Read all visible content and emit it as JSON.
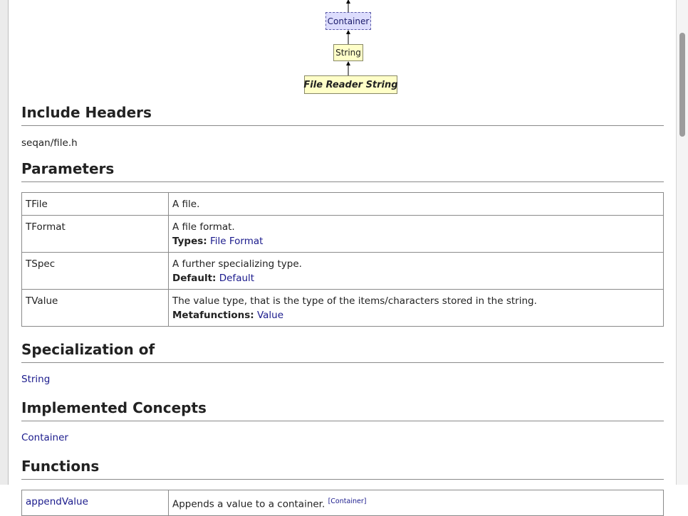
{
  "diagram": {
    "container_label": "Container",
    "string_label": "String",
    "current_label": "File Reader String"
  },
  "include_headers": {
    "heading": "Include Headers",
    "value": "seqan/file.h"
  },
  "parameters": {
    "heading": "Parameters",
    "rows": [
      {
        "name": "TFile",
        "desc": "A file.",
        "extra_label": "",
        "extra_link": ""
      },
      {
        "name": "TFormat",
        "desc": "A file format.",
        "extra_label": "Types:",
        "extra_link": "File Format"
      },
      {
        "name": "TSpec",
        "desc": "A further specializing type.",
        "extra_label": "Default:",
        "extra_link": "Default"
      },
      {
        "name": "TValue",
        "desc": "The value type, that is the type of the items/characters stored in the string.",
        "extra_label": "Metafunctions:",
        "extra_link": "Value"
      }
    ]
  },
  "specialization": {
    "heading": "Specialization of",
    "link": "String"
  },
  "implemented_concepts": {
    "heading": "Implemented Concepts",
    "link": "Container"
  },
  "functions": {
    "heading": "Functions",
    "rows": [
      {
        "name": "appendValue",
        "desc": "Appends a value to a container.",
        "tag": "[Container]"
      }
    ]
  }
}
